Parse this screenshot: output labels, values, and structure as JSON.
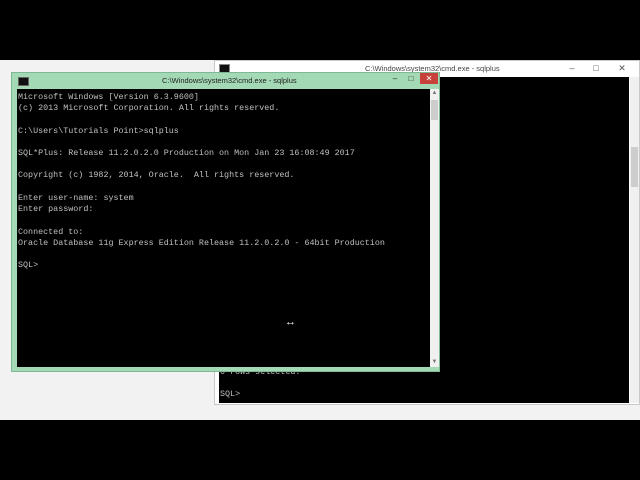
{
  "back_window": {
    "title": "C:\\Windows\\system32\\cmd.exe - sqlplus",
    "min_symbol": "–",
    "max_symbol": "□",
    "close_symbol": "✕",
    "lines": [
      "0 rows selected.",
      "",
      "SQL>"
    ]
  },
  "front_window": {
    "title": "C:\\Windows\\system32\\cmd.exe - sqlplus",
    "min_symbol": "–",
    "max_symbol": "□",
    "close_symbol": "✕",
    "scroll_up": "▲",
    "scroll_down": "▼",
    "lines": [
      "Microsoft Windows [Version 6.3.9600]",
      "(c) 2013 Microsoft Corporation. All rights reserved.",
      "",
      "C:\\Users\\Tutorials Point>sqlplus",
      "",
      "SQL*Plus: Release 11.2.0.2.0 Production on Mon Jan 23 16:08:49 2017",
      "",
      "Copyright (c) 1982, 2014, Oracle.  All rights reserved.",
      "",
      "Enter user-name: system",
      "Enter password:",
      "",
      "Connected to:",
      "Oracle Database 11g Express Edition Release 11.2.0.2.0 - 64bit Production",
      "",
      "SQL>"
    ]
  },
  "cursor": {
    "icon": "resize-horizontal-cursor",
    "glyph": "↔"
  }
}
